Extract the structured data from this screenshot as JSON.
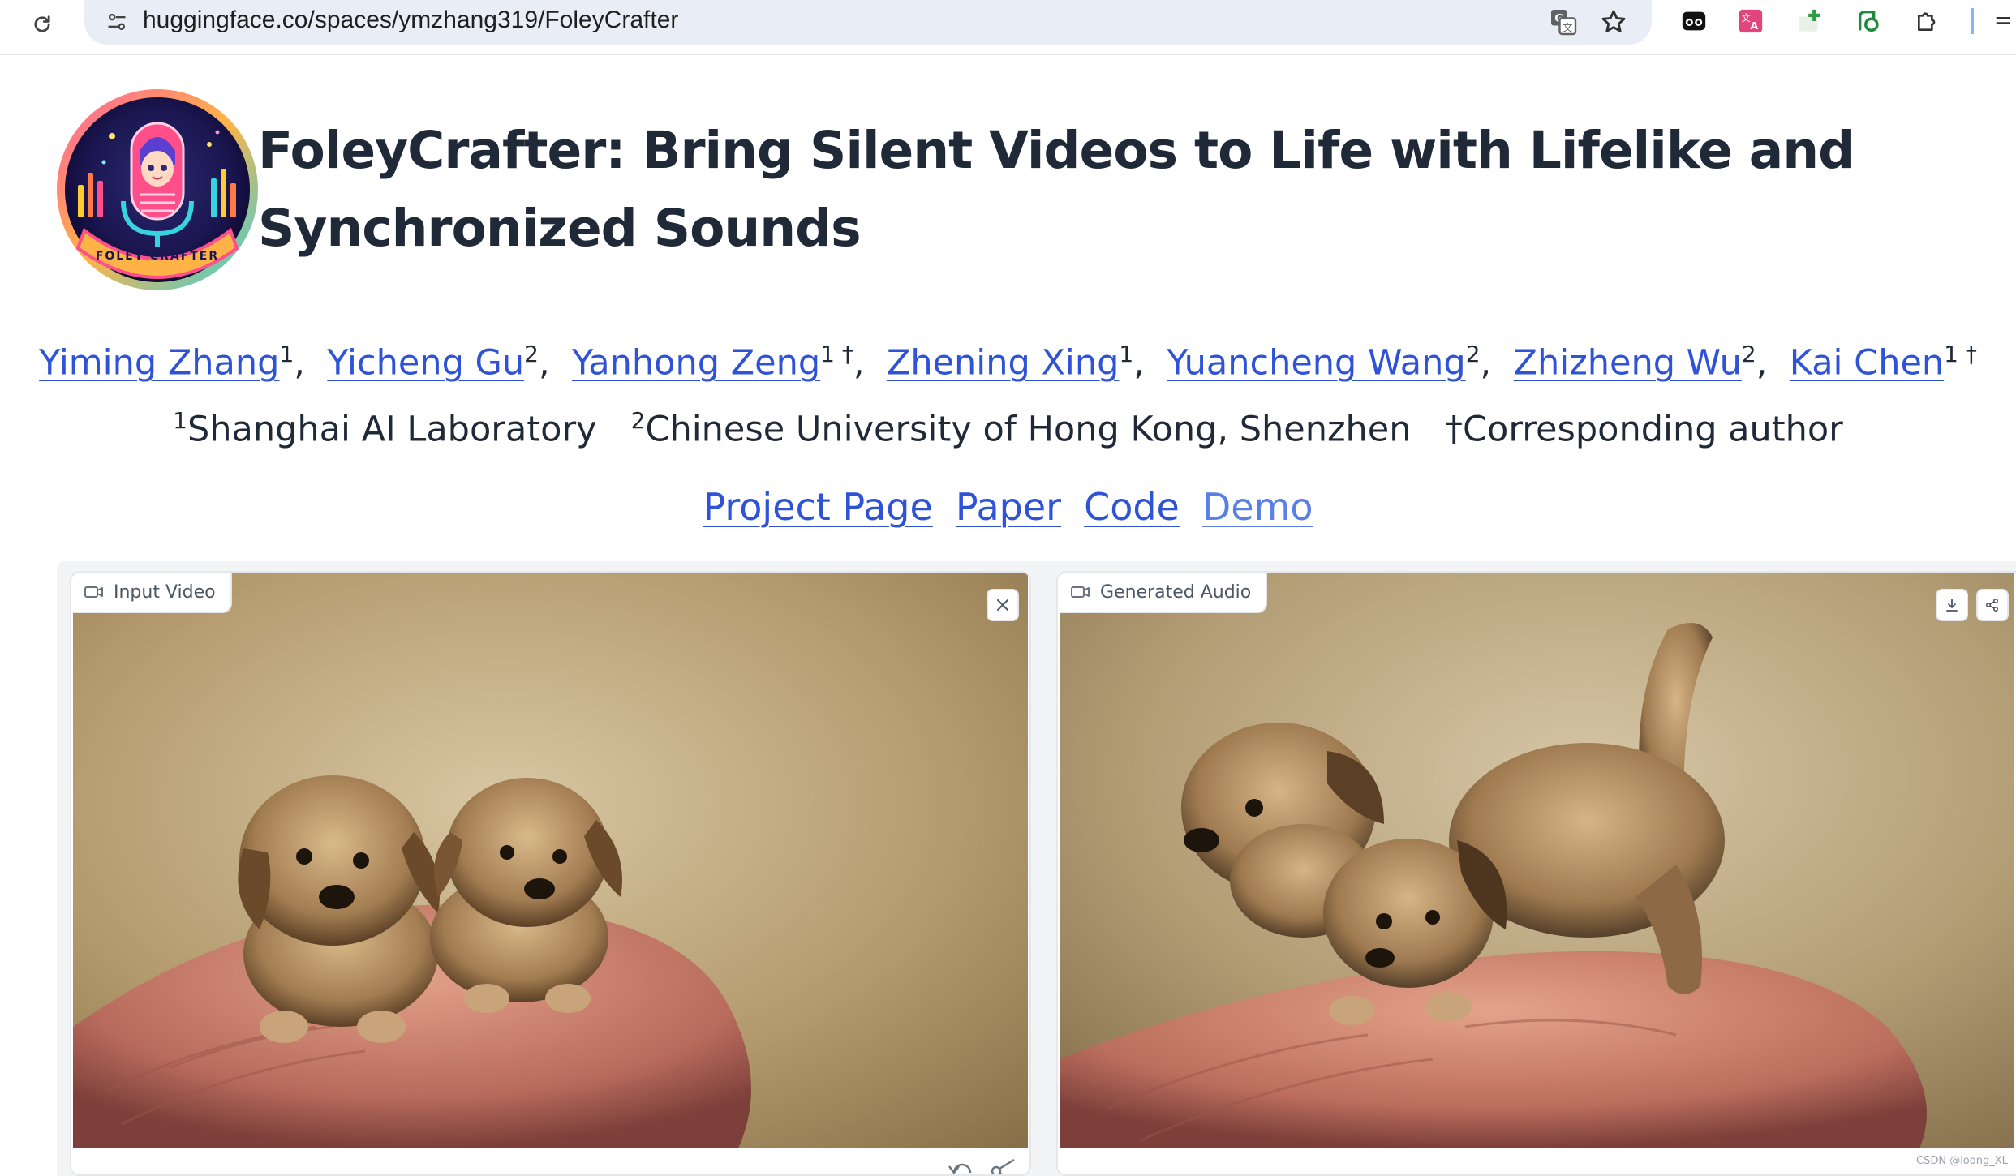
{
  "browser": {
    "url": "huggingface.co/spaces/ymzhang319/FoleyCrafter"
  },
  "page": {
    "logo_text": "FOLEY CRAFTER",
    "title": "FoleyCrafter: Bring Silent Videos to Life with Lifelike and Synchronized Sounds",
    "authors": [
      {
        "name": "Yiming Zhang",
        "sup": "1"
      },
      {
        "name": "Yicheng Gu",
        "sup": "2"
      },
      {
        "name": "Yanhong Zeng",
        "sup": "1 †"
      },
      {
        "name": "Zhening Xing",
        "sup": "1"
      },
      {
        "name": "Yuancheng Wang",
        "sup": "2"
      },
      {
        "name": "Zhizheng Wu",
        "sup": "2"
      },
      {
        "name": "Kai Chen",
        "sup": "1 †"
      }
    ],
    "affiliations": {
      "a1_sup": "1",
      "a1": "Shanghai AI Laboratory",
      "a2_sup": "2",
      "a2": "Chinese University of Hong Kong, Shenzhen",
      "corresponding": "†Corresponding author"
    },
    "links": {
      "project": "Project Page",
      "paper": "Paper",
      "code": "Code",
      "demo": "Demo"
    }
  },
  "panels": {
    "input_label": "Input Video",
    "output_label": "Generated Audio"
  },
  "watermark": "CSDN @loong_XL",
  "icons": {
    "reload": "reload-icon",
    "site_info": "tune-icon",
    "translate": "translate-icon",
    "bookmark": "star-icon",
    "close": "close-icon",
    "download": "download-icon",
    "share": "share-icon",
    "camera": "video-camera-icon",
    "undo": "undo-icon",
    "trim": "scissors-icon"
  },
  "colors": {
    "link": "#2e53d6",
    "visited_link": "#5a7fe6",
    "title": "#1f2937",
    "omnibox": "#e9eef6"
  }
}
